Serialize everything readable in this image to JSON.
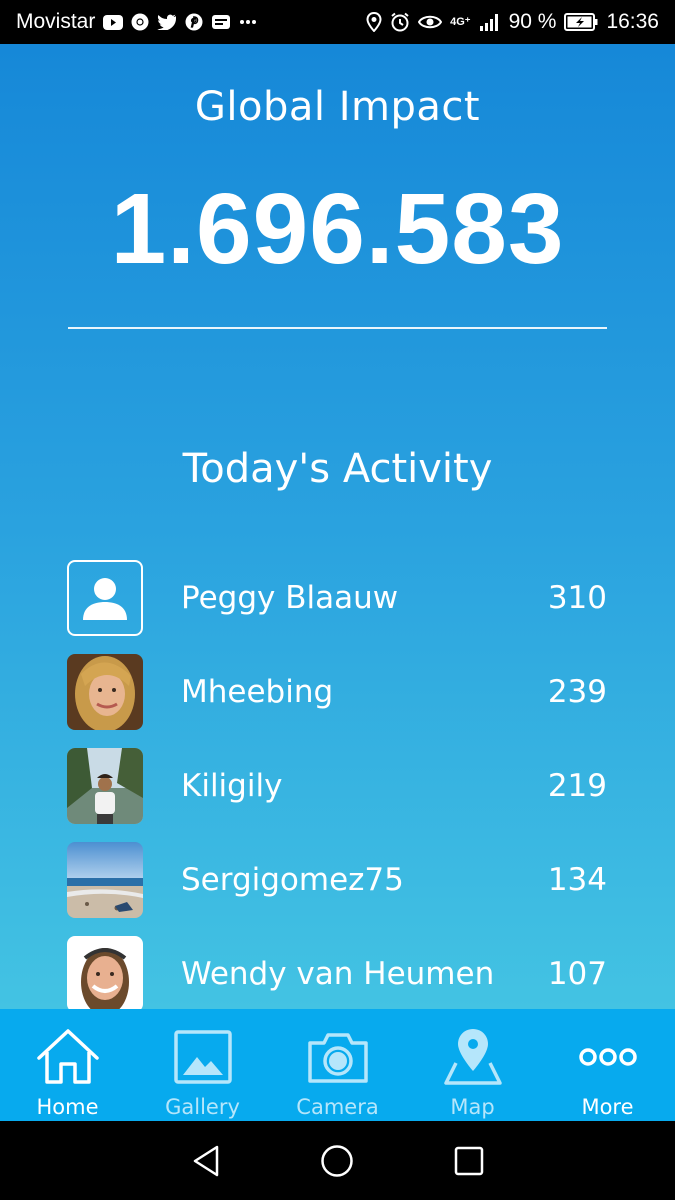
{
  "status_bar": {
    "carrier": "Movistar",
    "battery": "90 %",
    "network": "4G⁺",
    "time": "16:36",
    "notification_icons": [
      "youtube-icon",
      "chrome-icon",
      "twitter-icon",
      "pinterest-icon",
      "message-icon",
      "more-dots-icon"
    ],
    "system_icons": [
      "location-icon",
      "alarm-icon",
      "eye-icon",
      "signal-icon",
      "battery-icon"
    ]
  },
  "header": {
    "title": "Global Impact",
    "value": "1.696.583"
  },
  "activity": {
    "title": "Today's Activity",
    "items": [
      {
        "name": "Peggy Blaauw",
        "score": "310",
        "avatar": "placeholder-person-icon"
      },
      {
        "name": "Mheebing",
        "score": "239",
        "avatar": "photo-woman-blonde"
      },
      {
        "name": "Kiligily",
        "score": "219",
        "avatar": "photo-person-coast"
      },
      {
        "name": "Sergigomez75",
        "score": "134",
        "avatar": "photo-beach"
      },
      {
        "name": "Wendy van Heumen",
        "score": "107",
        "avatar": "photo-woman-smiling"
      }
    ]
  },
  "tabs": [
    {
      "label": "Home",
      "icon": "home-icon",
      "active": true
    },
    {
      "label": "Gallery",
      "icon": "gallery-icon",
      "active": false
    },
    {
      "label": "Camera",
      "icon": "camera-icon",
      "active": false
    },
    {
      "label": "Map",
      "icon": "map-pin-icon",
      "active": false
    },
    {
      "label": "More",
      "icon": "more-icon",
      "active": true
    }
  ],
  "nav": [
    "back-icon",
    "home-circle-icon",
    "recents-icon"
  ],
  "colors": {
    "gradient_top": "#1688d8",
    "gradient_bottom": "#43c3e3",
    "tab_bar": "#07aaee"
  }
}
